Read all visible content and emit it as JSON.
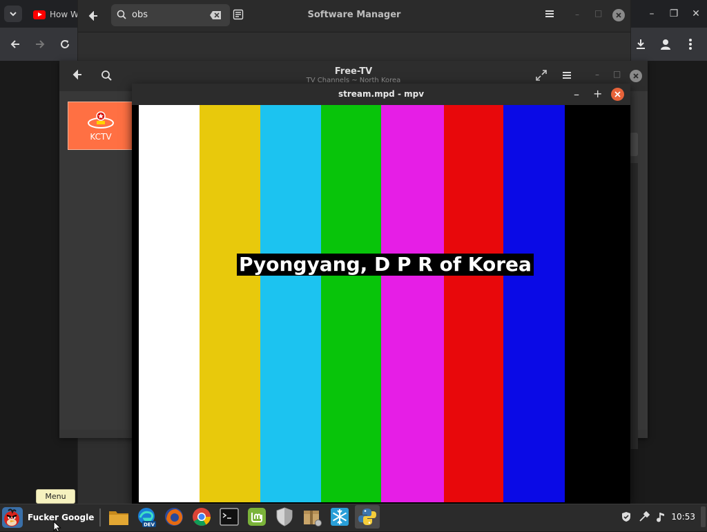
{
  "browser": {
    "tab_title": "How W",
    "tab_icon": "youtube-icon"
  },
  "software_manager": {
    "title": "Software Manager",
    "search_value": "obs"
  },
  "free_tv": {
    "title": "Free-TV",
    "subtitle": "TV Channels ~ North Korea",
    "channels": [
      {
        "label": "KCTV",
        "color": "#ff7043"
      }
    ]
  },
  "mpv": {
    "title": "stream.mpd - mpv",
    "caption": "Pyongyang, D P R of Korea",
    "color_bars": [
      "#ffffff",
      "#e8c90c",
      "#1cc3f0",
      "#08c40a",
      "#e61ee6",
      "#e8080b",
      "#0a0ae6",
      "#000000"
    ]
  },
  "taskbar": {
    "menu_tooltip": "Menu",
    "start_label": "Fucker Google",
    "clock": "10:53",
    "apps": [
      "files-icon",
      "edge-dev-icon",
      "firefox-icon",
      "chrome-icon",
      "terminal-icon",
      "mintupdate-icon",
      "shield-icon",
      "archive-manager-icon",
      "snowflake-icon",
      "python-icon"
    ]
  }
}
